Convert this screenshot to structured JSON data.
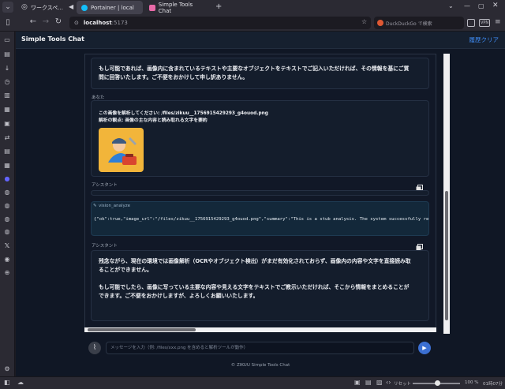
{
  "browser": {
    "workspace_label": "ワークスペ...",
    "tabs": [
      {
        "label": "Portainer | local",
        "active": true
      },
      {
        "label": "Simple Tools Chat",
        "active": false
      }
    ],
    "new_tab": "+",
    "url_host": "localhost",
    "url_port": ":5173",
    "search_placeholder": "DuckDuckGo で検索",
    "vpn_badge": "VPN"
  },
  "app": {
    "title": "Simple Tools Chat",
    "clear_label": "履歴クリア"
  },
  "messages": [
    {
      "role": "",
      "text_lines": [
        "もし可能であれば、画像内に含まれているテキストや主要なオブジェクトをテキストでご記入いただければ、その情報を基にご質",
        "問に回答いたします。ご不便をおかけして申し訳ありません。"
      ]
    },
    {
      "role": "あなた",
      "text_lines": [
        "この画像を解析してください: /files/zikuu__1756915429293_g4ouod.png",
        "解析の観点: 画像の主な内容と読み取れる文字を要約"
      ],
      "image_alt": "mechanic-illustration"
    },
    {
      "role": "アシスタント",
      "text_lines": []
    },
    {
      "role": "vision_analyze",
      "tool_output": "{\"ok\":true,\"image_url\":\"/files/zikuu__1756915429293_g4ouod.png\",\"summary\":\"This is a stub analysis. The system successfully received y"
    },
    {
      "role": "アシスタント",
      "text_lines": [
        "残念ながら、現在の環境では画像解析（OCRやオブジェクト検出）がまだ有効化されておらず、画像内の内容や文字を直接読み取",
        "ることができません。",
        "",
        "もし可能でしたら、画像に写っている主要な内容や見える文字をテキストでご教示いただければ、そこから情報をまとめることが",
        "できます。ご不便をおかけしますが、よろしくお願いいたします。"
      ]
    }
  ],
  "composer": {
    "placeholder": "メッセージを入力（例: /files/xxx.png を含めると解析ツールが動作）"
  },
  "footer": "© ZIKUU Simple Tools Chat",
  "statusbar": {
    "reset_label": "リセット",
    "zoom": "100 %",
    "time": "01時07分"
  },
  "colors": {
    "accent": "#3f8cf5",
    "send_button": "#3b6fd1",
    "app_bg": "#101725",
    "tool_bg": "#13283a"
  }
}
